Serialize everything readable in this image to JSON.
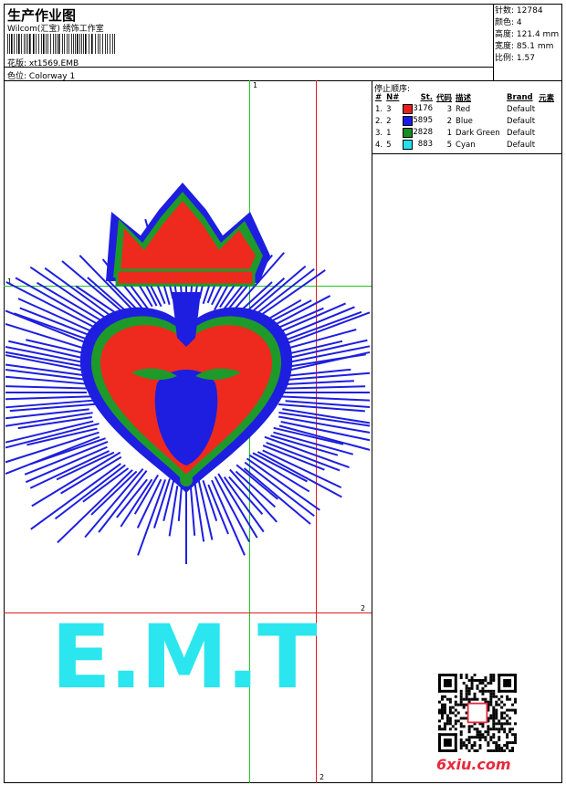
{
  "header": {
    "title": "生产作业图",
    "company": "Wilcom(汇宝) 绣饰工作室",
    "design_label": "花版:",
    "design_file": "xt1569.EMB",
    "colorway_label": "色位:",
    "colorway": "Colorway 1"
  },
  "stats": [
    {
      "label": "针数:",
      "value": "12784"
    },
    {
      "label": "颜色:",
      "value": "4"
    },
    {
      "label": "高度:",
      "value": "121.4 mm"
    },
    {
      "label": "宽度:",
      "value": "85.1 mm"
    },
    {
      "label": "比例:",
      "value": "1.57"
    }
  ],
  "stop_sequence": {
    "title": "停止顺序:",
    "columns": [
      "#",
      "N#",
      "St.",
      "代码",
      "描述",
      "Brand",
      "元素"
    ],
    "rows": [
      {
        "num": "1.",
        "n": "3",
        "color": "#e8201c",
        "st": "3176",
        "code": "3",
        "desc": "Red",
        "brand": "Default"
      },
      {
        "num": "2.",
        "n": "2",
        "color": "#1a1ae6",
        "st": "5895",
        "code": "2",
        "desc": "Blue",
        "brand": "Default"
      },
      {
        "num": "3.",
        "n": "1",
        "color": "#1a8c1a",
        "st": "2828",
        "code": "1",
        "desc": "Dark Green",
        "brand": "Default"
      },
      {
        "num": "4.",
        "n": "5",
        "color": "#22e0ee",
        "st": "883",
        "code": "5",
        "desc": "Cyan",
        "brand": "Default"
      }
    ]
  },
  "guides": {
    "green_label_top": "1",
    "green_label_left": "1",
    "red_label_right": "2",
    "red_label_bottom": "2"
  },
  "design": {
    "text": "E.M.T",
    "colors": {
      "red": "#ee2a1e",
      "blue": "#1e1ee0",
      "green": "#1e9a2a",
      "cyan": "#2be6ee"
    }
  },
  "watermark": {
    "site": "6xiu.com"
  }
}
